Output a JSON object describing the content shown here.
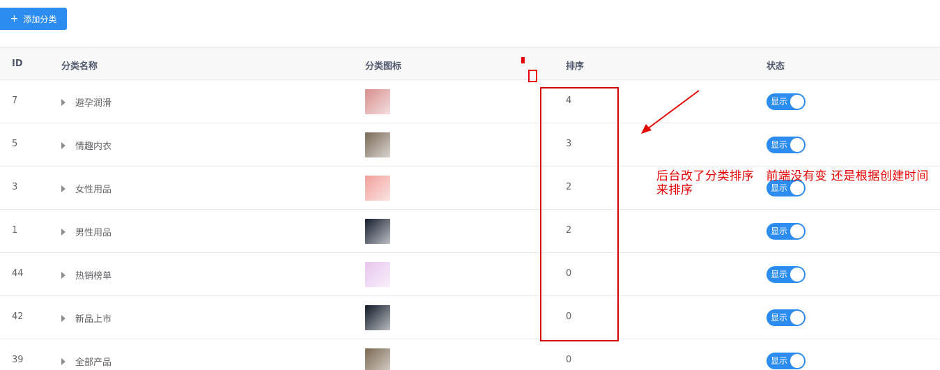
{
  "toolbar": {
    "add_label": "添加分类",
    "add_plus": "+"
  },
  "table": {
    "headers": {
      "id": "ID",
      "name": "分类名称",
      "icon": "分类图标",
      "sort": "排序",
      "status": "状态"
    },
    "rows": [
      {
        "id": "7",
        "name": "避孕润滑",
        "sort": "4",
        "status": "显示",
        "thumb_color": "#d88e8e"
      },
      {
        "id": "5",
        "name": "情趣内衣",
        "sort": "3",
        "status": "显示",
        "thumb_color": "#7a6a58"
      },
      {
        "id": "3",
        "name": "女性用品",
        "sort": "2",
        "status": "显示",
        "thumb_color": "#f2a09a"
      },
      {
        "id": "1",
        "name": "男性用品",
        "sort": "2",
        "status": "显示",
        "thumb_color": "#141c2c"
      },
      {
        "id": "44",
        "name": "热销榜单",
        "sort": "0",
        "status": "显示",
        "thumb_color": "#e8c6ee"
      },
      {
        "id": "42",
        "name": "新品上市",
        "sort": "0",
        "status": "显示",
        "thumb_color": "#0e1826"
      },
      {
        "id": "39",
        "name": "全部产品",
        "sort": "0",
        "status": "显示",
        "thumb_color": "#7a6650"
      }
    ]
  },
  "annotation": {
    "text": "后台改了分类排序　前端没有变  还是根据创建时间来排序"
  },
  "colors": {
    "accent": "#2d8cf0",
    "annotation_red": "#e60000"
  }
}
